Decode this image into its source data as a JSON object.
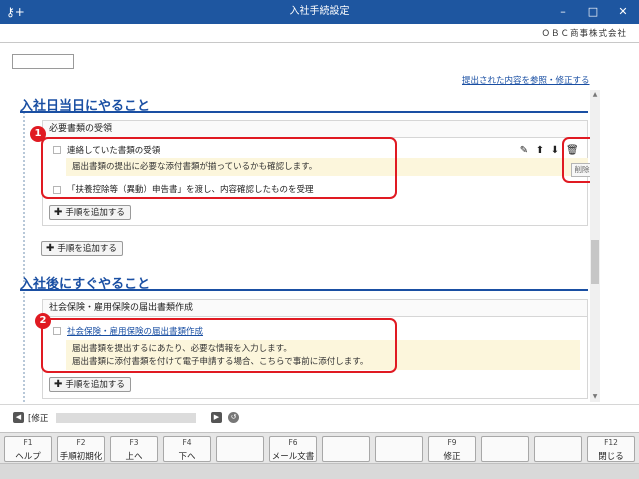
{
  "window": {
    "title": "入社手続設定",
    "minimize": "–",
    "maximize": "□",
    "close": "✕"
  },
  "company": "ＯＢＣ商事株式会社",
  "link_reference": "提出された内容を参照・修正する",
  "sections": [
    {
      "title": "入社日当日にやること",
      "cards": [
        {
          "header": "必要書類の受領",
          "steps": [
            {
              "label": "連絡していた書類の受領",
              "note": "届出書類の提出に必要な添付書類が揃っているかも確認します。"
            },
            {
              "label": "「扶養控除等（異動）申告書」を渡し、内容確認したものを受理"
            }
          ],
          "add_step": "手順を追加する"
        }
      ],
      "add_step": "手順を追加する"
    },
    {
      "title": "入社後にすぐやること",
      "cards": [
        {
          "header": "社会保険・雇用保険の届出書類作成",
          "steps": [
            {
              "label": "社会保険・雇用保険の届出書類作成",
              "note_lines": [
                "届出書類を提出するにあたり、必要な情報を入力します。",
                "届出書類に添付書類を付けて電子申請する場合、こちらで事前に添付します。"
              ]
            }
          ],
          "add_step": "手順を追加する"
        }
      ]
    }
  ],
  "badges": [
    "1",
    "2"
  ],
  "delete_label": "削除",
  "record_bar": {
    "label": "[修正"
  },
  "function_keys": [
    {
      "code": "F1",
      "label": "ヘルプ"
    },
    {
      "code": "F2",
      "label": "手順初期化"
    },
    {
      "code": "F3",
      "label": "上へ"
    },
    {
      "code": "F4",
      "label": "下へ"
    },
    {
      "code": "",
      "label": ""
    },
    {
      "code": "F6",
      "label": "メール文書"
    },
    {
      "code": "",
      "label": ""
    },
    {
      "code": "",
      "label": ""
    },
    {
      "code": "F9",
      "label": "修正"
    },
    {
      "code": "",
      "label": ""
    },
    {
      "code": "",
      "label": ""
    },
    {
      "code": "F12",
      "label": "閉じる"
    }
  ]
}
